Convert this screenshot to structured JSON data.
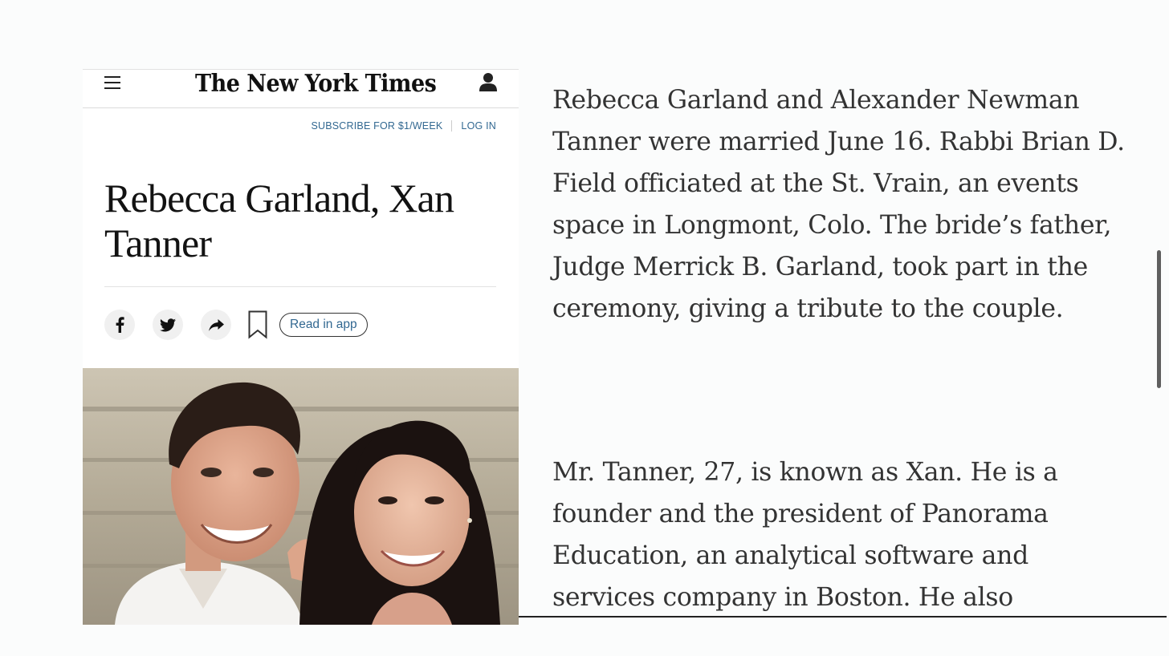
{
  "header": {
    "logo": "The New York Times",
    "menu_icon": "hamburger-menu-icon",
    "account_icon": "user-account-icon"
  },
  "subscribe_bar": {
    "subscribe_label": "SUBSCRIBE FOR $1/WEEK",
    "login_label": "LOG IN"
  },
  "article": {
    "headline": "Rebecca Garland, Xan Tanner",
    "read_in_app_label": "Read in app",
    "share_icons": [
      "facebook-icon",
      "twitter-icon",
      "share-arrow-icon",
      "bookmark-icon"
    ],
    "paragraphs": [
      "Rebecca Garland and Alexander Newman Tanner were married June 16. Rabbi Brian D. Field officiated at the St. Vrain, an events space in Longmont, Colo. The bride’s father, Judge Merrick B. Garland, took part in the ceremony, giving a tribute to the couple.",
      "Mr. Tanner, 27, is known as Xan. He is a founder and the president of Panorama Education, an analytical software and services company in Boston. He also"
    ]
  },
  "colors": {
    "link_blue": "#326891",
    "body_text": "#333333",
    "headline_text": "#121212"
  }
}
